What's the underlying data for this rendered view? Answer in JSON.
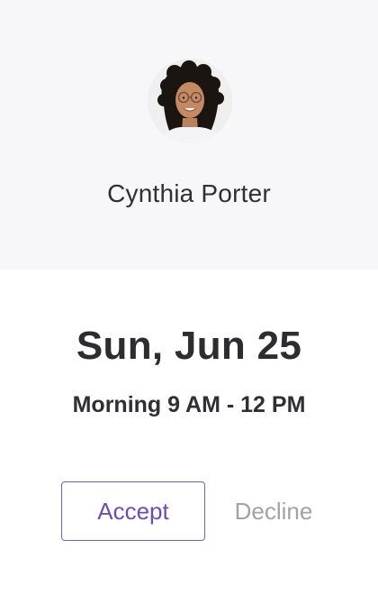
{
  "contact": {
    "name": "Cynthia Porter",
    "avatar_alt": "avatar"
  },
  "appointment": {
    "date": "Sun, Jun 25",
    "time_slot": "Morning 9 AM - 12 PM"
  },
  "actions": {
    "accept_label": "Accept",
    "decline_label": "Decline"
  },
  "colors": {
    "accent": "#7c5db8",
    "header_bg": "#f7f7f9",
    "muted_text": "#a2a2ab",
    "primary_text": "#2f2f35"
  }
}
